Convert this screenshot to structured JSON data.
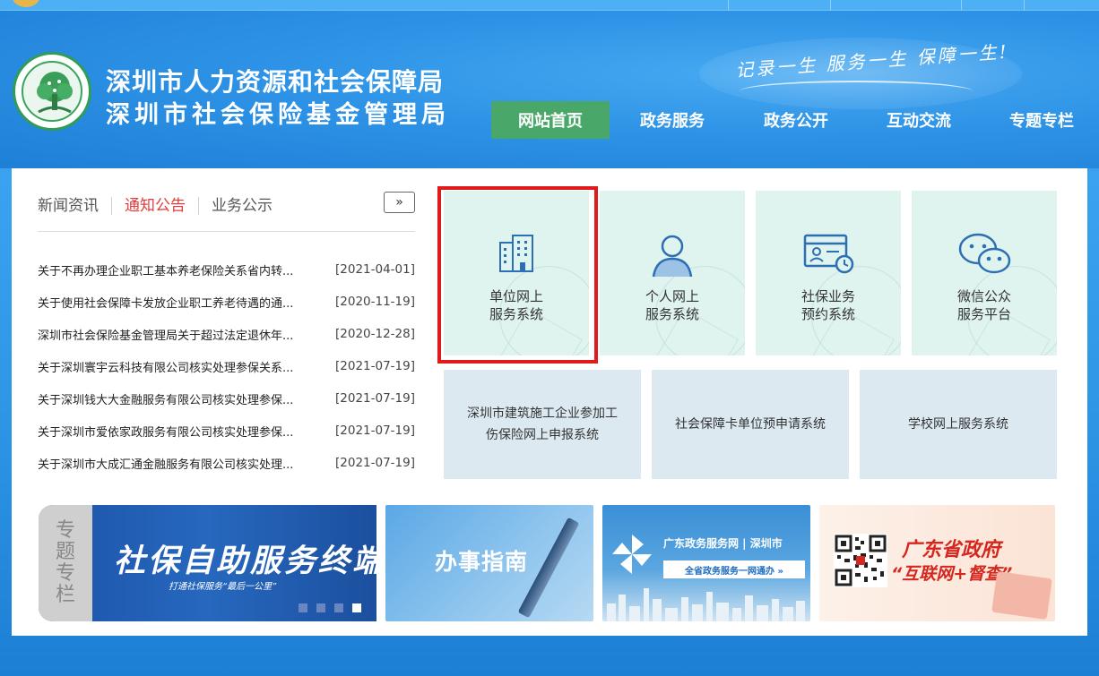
{
  "header": {
    "org_name_1": "深圳市人力资源和社会保障局",
    "org_name_2": "深圳市社会保险基金管理局",
    "slogan": "记录一生 服务一生 保障一生!"
  },
  "nav": [
    {
      "label": "网站首页",
      "active": true
    },
    {
      "label": "政务服务"
    },
    {
      "label": "政务公开"
    },
    {
      "label": "互动交流"
    },
    {
      "label": "专题专栏"
    }
  ],
  "news": {
    "tabs": [
      "新闻资讯",
      "通知公告",
      "业务公示"
    ],
    "active_tab": "通知公告",
    "more": "»",
    "items": [
      {
        "title": "关于不再办理企业职工基本养老保险关系省内转...",
        "date": "[2021-04-01]"
      },
      {
        "title": "关于使用社会保障卡发放企业职工养老待遇的通...",
        "date": "[2020-11-19]"
      },
      {
        "title": "深圳市社会保险基金管理局关于超过法定退休年...",
        "date": "[2020-12-28]"
      },
      {
        "title": "关于深圳寰宇云科技有限公司核实处理参保关系...",
        "date": "[2021-07-19]"
      },
      {
        "title": "关于深圳钱大大金融服务有限公司核实处理参保...",
        "date": "[2021-07-19]"
      },
      {
        "title": "关于深圳市爱依家政服务有限公司核实处理参保...",
        "date": "[2021-07-19]"
      },
      {
        "title": "关于深圳市大成汇通金融服务有限公司核实处理...",
        "date": "[2021-07-19]"
      }
    ]
  },
  "services": [
    {
      "line1": "单位网上",
      "line2": "服务系统",
      "icon": "building-icon"
    },
    {
      "line1": "个人网上",
      "line2": "服务系统",
      "icon": "person-icon"
    },
    {
      "line1": "社保业务",
      "line2": "预约系统",
      "icon": "appointment-icon"
    },
    {
      "line1": "微信公众",
      "line2": "服务平台",
      "icon": "wechat-icon"
    }
  ],
  "services2": [
    {
      "label": "深圳市建筑施工企业参加工伤保险网上申报系统"
    },
    {
      "label": "社会保障卡单位预申请系统"
    },
    {
      "label": "学校网上服务系统"
    }
  ],
  "banners": {
    "special_side": [
      "专",
      "题",
      "专",
      "栏"
    ],
    "selfservice_title": "社保自助服务终端",
    "selfservice_sub": "打通社保服务“最后一公里”",
    "guide": "办事指南",
    "gd_gov_title": "广东政务服务网 | 深圳市",
    "gd_gov_sub": "全省政务服务一网通办 »",
    "supervise_1": "广东省政府",
    "supervise_2": "“互联网+督查”"
  },
  "colors": {
    "active_nav": "#4aa76a",
    "active_tab": "#e23a3a",
    "highlight_box": "#e01a1a",
    "tile_bg": "#dff3ef"
  }
}
